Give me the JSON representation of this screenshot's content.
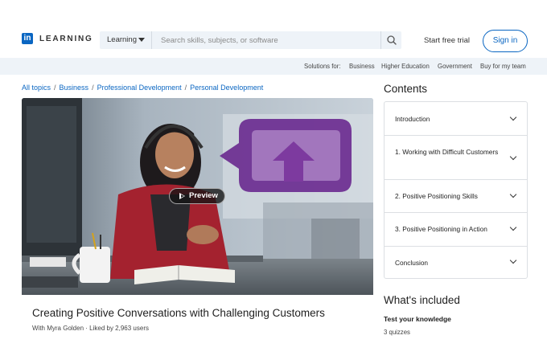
{
  "header": {
    "logo_mark": "in",
    "logo_text": "LEARNING",
    "search_category": "Learning",
    "search_placeholder": "Search skills, subjects, or software",
    "start_trial": "Start free trial",
    "sign_in": "Sign in",
    "icons": [
      "chevron-down-icon",
      "search-icon"
    ]
  },
  "subnav": {
    "label": "Solutions for:",
    "items": [
      "Business",
      "Higher Education",
      "Government",
      "Buy for my team"
    ]
  },
  "breadcrumb": [
    "All topics",
    "Business",
    "Professional Development",
    "Personal Development"
  ],
  "hero": {
    "preview_label": "Preview",
    "icons": [
      "play-icon"
    ]
  },
  "course": {
    "title": "Creating Positive Conversations with Challenging Customers",
    "author": "With Myra Golden",
    "likes": "Liked by 2,963 users"
  },
  "contents": {
    "heading": "Contents",
    "items": [
      "Introduction",
      "1. Working with Difficult Customers",
      "2. Positive Positioning Skills",
      "3. Positive Positioning in Action",
      "Conclusion"
    ]
  },
  "included": {
    "heading": "What's included",
    "item_title": "Test your knowledge",
    "item_detail": "3 quizzes"
  },
  "colors": {
    "accent": "#0a66c2",
    "subnav_bg": "#eef3f8",
    "logo_purple": "#6b2d90"
  }
}
